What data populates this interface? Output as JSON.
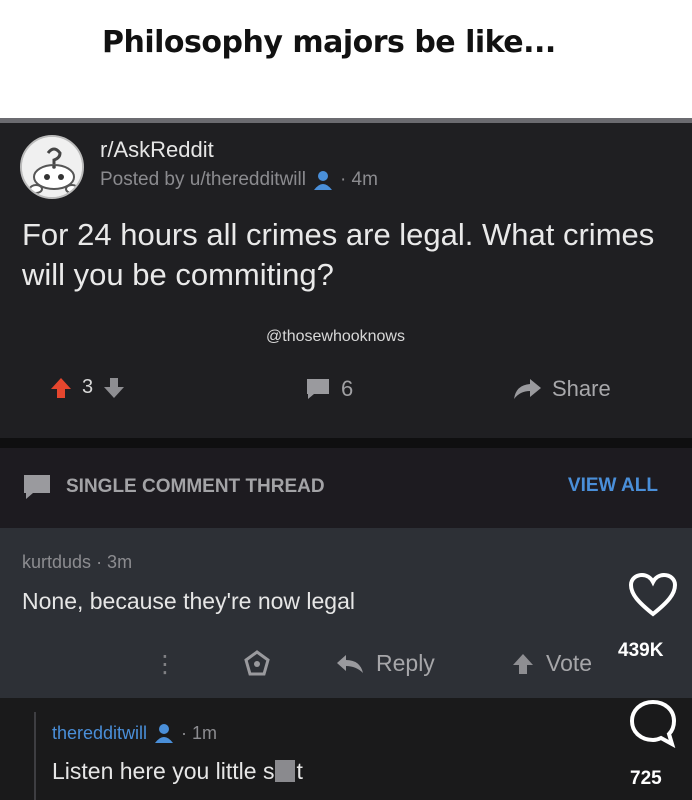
{
  "caption": {
    "text": "Philosophy majors be like..."
  },
  "post": {
    "subreddit": "r/AskReddit",
    "posted_by": "Posted by u/theredditwill",
    "age": "· 4m",
    "title": "For 24 hours all crimes are legal. What crimes will you be commiting?",
    "watermark": "@thosewhooknows",
    "upvotes": "3",
    "comments": "6",
    "share_label": "Share"
  },
  "thread": {
    "label": "SINGLE COMMENT THREAD",
    "view_all": "VIEW ALL"
  },
  "comment": {
    "author": "kurtduds",
    "age": "· 3m",
    "body": "None, because they're now legal",
    "reply_label": "Reply",
    "vote_label": "Vote"
  },
  "reply": {
    "author": "theredditwill",
    "age": "· 1m",
    "body_before": "Listen here you little s",
    "body_after": "t"
  },
  "overlay": {
    "likes": "439K",
    "comment_count": "725"
  },
  "colors": {
    "accent_blue": "#4a8fd9",
    "upvote_red": "#e5462e",
    "background": "#1a1a1b"
  }
}
